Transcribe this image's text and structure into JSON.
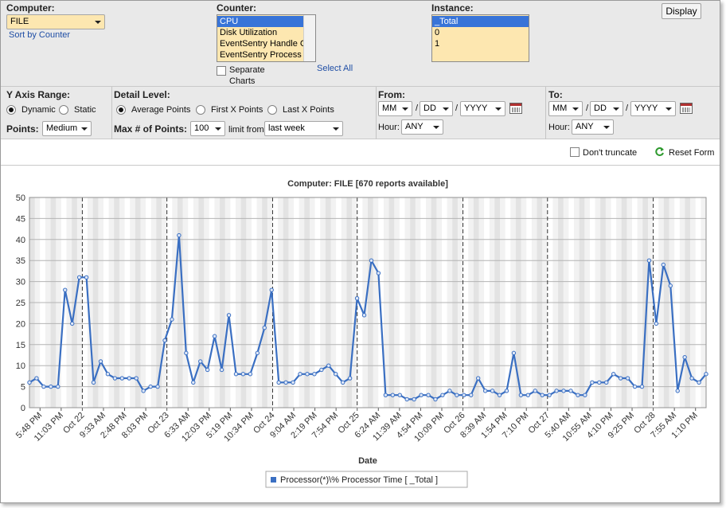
{
  "computer": {
    "label": "Computer:",
    "value": "FILE",
    "sort_link": "Sort by Counter"
  },
  "counter": {
    "label": "Counter:",
    "options": [
      "CPU",
      "Disk Utilization",
      "EventSentry Handle C",
      "EventSentry Process"
    ],
    "selected": "CPU",
    "separate_charts": "Separate Charts",
    "select_all": "Select All"
  },
  "instance": {
    "label": "Instance:",
    "options": [
      "_Total",
      "0",
      "1"
    ],
    "selected": "_Total"
  },
  "display_button": "Display",
  "y_axis": {
    "label": "Y Axis Range:",
    "dynamic": "Dynamic",
    "static": "Static"
  },
  "points": {
    "label": "Points:",
    "value": "Medium"
  },
  "detail": {
    "label": "Detail Level:",
    "average": "Average Points",
    "first_x": "First X Points",
    "last_x": "Last X Points"
  },
  "max_points": {
    "label": "Max # of Points:",
    "value": "100",
    "limit_label": "limit from",
    "limit_value": "last week"
  },
  "from": {
    "label": "From:",
    "mm": "MM",
    "dd": "DD",
    "yyyy": "YYYY",
    "hour_label": "Hour:",
    "hour": "ANY"
  },
  "to": {
    "label": "To:",
    "mm": "MM",
    "dd": "DD",
    "yyyy": "YYYY",
    "hour_label": "Hour:",
    "hour": "ANY"
  },
  "dont_truncate": "Don't truncate",
  "reset_form": "Reset Form",
  "chart_data": {
    "type": "line",
    "title": "Computer: FILE [670 reports available]",
    "xlabel": "Date",
    "ylabel": "",
    "ylim": [
      0,
      50
    ],
    "yticks": [
      0,
      5,
      10,
      15,
      20,
      25,
      30,
      35,
      40,
      45,
      50
    ],
    "grid": true,
    "legend": "bottom",
    "color": "#3a6fc2",
    "x_tick_labels": [
      "5:48 PM",
      "11:03 PM",
      "Oct 22",
      "9:33 AM",
      "2:48 PM",
      "8:03 PM",
      "Oct 23",
      "6:33 AM",
      "12:03 PM",
      "5:19 PM",
      "10:34 PM",
      "Oct 24",
      "9:04 AM",
      "2:19 PM",
      "7:54 PM",
      "Oct 25",
      "6:24 AM",
      "11:39 AM",
      "4:54 PM",
      "10:09 PM",
      "Oct 26",
      "8:39 AM",
      "1:54 PM",
      "7:10 PM",
      "Oct 27",
      "5:40 AM",
      "10:55 AM",
      "4:10 PM",
      "9:25 PM",
      "Oct 28",
      "7:55 AM",
      "1:10 PM"
    ],
    "series": [
      {
        "name": "Processor(*)\\% Processor Time [ _Total ]",
        "values": [
          6,
          7,
          5,
          5,
          5,
          28,
          20,
          31,
          31,
          6,
          11,
          8,
          7,
          7,
          7,
          7,
          4,
          5,
          5,
          16,
          21,
          41,
          13,
          6,
          11,
          9,
          17,
          9,
          22,
          8,
          8,
          8,
          13,
          19,
          28,
          6,
          6,
          6,
          8,
          8,
          8,
          9,
          10,
          8,
          6,
          7,
          26,
          22,
          35,
          32,
          3,
          3,
          3,
          2,
          2,
          3,
          3,
          2,
          3,
          4,
          3,
          3,
          3,
          7,
          4,
          4,
          3,
          4,
          13,
          3,
          3,
          4,
          3,
          3,
          4,
          4,
          4,
          3,
          3,
          6,
          6,
          6,
          8,
          7,
          7,
          5,
          5,
          35,
          20,
          34,
          29,
          4,
          12,
          7,
          6,
          8
        ]
      }
    ]
  }
}
